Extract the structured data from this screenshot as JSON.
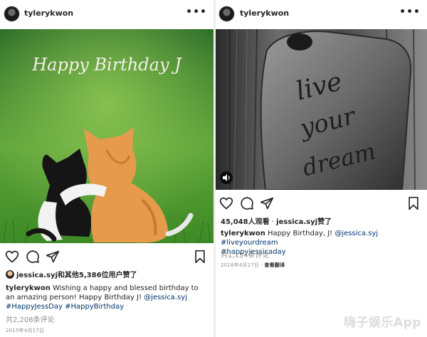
{
  "left_post": {
    "username": "tylerykwon",
    "more_icon": "more-horizontal-icon",
    "photo_text": "Happy Birthday J",
    "liked_by": "jessica.syj",
    "liked_suffix": "和其他5,386位用户赞了",
    "caption_user": "tylerykwon",
    "caption_text": "Wishing a happy and blessed birthday to an amazing person! Happy Birthday J! ",
    "caption_mention": "@jessica.syj",
    "caption_tag1": "#HappyJessDay",
    "caption_tag2": "#HappyBirthday",
    "comments": "共2,208条评论",
    "date": "2015年4月17日"
  },
  "right_post": {
    "username": "tylerykwon",
    "more_icon": "more-horizontal-icon",
    "photo_text_1": "live",
    "photo_text_2": "your",
    "photo_text_3": "dream",
    "views": "45,048人观看",
    "views_sep": " · ",
    "liked_by": "jessica.syj",
    "liked_suffix": "赞了",
    "caption_user": "tylerykwon",
    "caption_text": " Happy Birthday, J! ",
    "caption_mention": "@jessica.syj",
    "caption_tag1": "#liveyourdream",
    "caption_tag2": "#happyjessicaday",
    "comments": "共1,154条评论",
    "date": "2016年4月17日",
    "date_sep": " · ",
    "see_translation": "查看翻译"
  },
  "watermark": "嗨子娱乐App",
  "icons": [
    "heart-icon",
    "comment-icon",
    "share-icon",
    "bookmark-icon",
    "video-icon"
  ],
  "colors": {
    "link": "#003569",
    "muted": "#8e8e8e",
    "text": "#262626"
  }
}
